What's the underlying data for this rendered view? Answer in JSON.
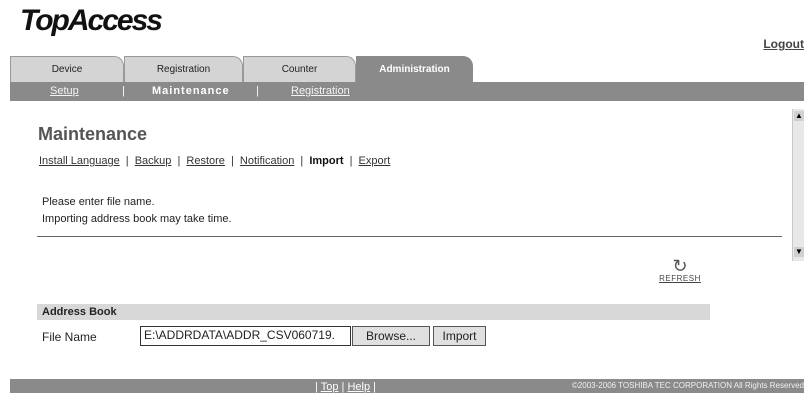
{
  "app": {
    "logo": "TopAccess",
    "logout": "Logout"
  },
  "tabs": [
    {
      "label": "Device"
    },
    {
      "label": "Registration"
    },
    {
      "label": "Counter"
    },
    {
      "label": "Administration"
    }
  ],
  "subnav": {
    "setup": "Setup",
    "maintenance": "Maintenance",
    "registration": "Registration",
    "sep": "|"
  },
  "page": {
    "title": "Maintenance",
    "nav": [
      "Install Language",
      "Backup",
      "Restore",
      "Notification",
      "Import",
      "Export"
    ],
    "sep": "|",
    "messages": [
      "Please enter file name.",
      "Importing address book may take time."
    ]
  },
  "refresh": {
    "label": "REFRESH"
  },
  "address_book": {
    "heading": "Address Book",
    "file_label": "File Name",
    "file_value": "E:\\ADDRDATA\\ADDR_CSV060719.",
    "browse": "Browse...",
    "import": "Import"
  },
  "footer": {
    "top": "Top",
    "help": "Help",
    "sep": "|",
    "copyright": "©2003-2006 TOSHIBA TEC CORPORATION All Rights Reserved"
  }
}
